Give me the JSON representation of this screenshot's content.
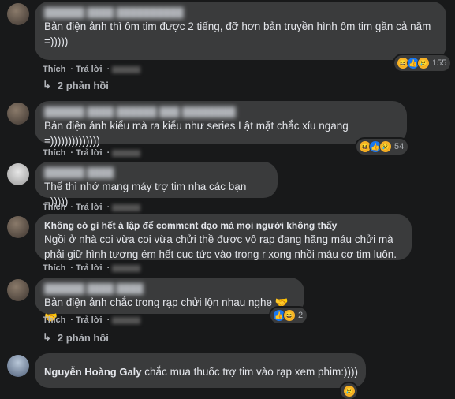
{
  "actions": {
    "like": "Thích",
    "reply": "Trả lời"
  },
  "comments": [
    {
      "name": "",
      "text": "Bản điện ảnh thì ôm tim được 2 tiếng, đỡ hơn bản truyền hình ôm tim gần cả năm =)))))",
      "reaction_count": "155",
      "reactions": [
        "haha-icon",
        "like-icon",
        "sad-icon"
      ],
      "replies": "2 phản hồi"
    },
    {
      "name": "",
      "text": "Bản điện ảnh kiểu mà ra kiểu như series Lật mặt chắc xỉu ngang =))))))))))))))",
      "reaction_count": "54",
      "reactions": [
        "haha-icon",
        "like-icon",
        "sad-icon"
      ]
    },
    {
      "name": "",
      "text": "Thế thì nhớ mang máy trợ tim nha các bạn =)))))"
    },
    {
      "name": "Không có gì hết á lập để comment dạo mà mọi người không thấy",
      "text": "Ngồi ở nhà coi vừa coi vừa chửi thề được vô rạp đang hăng máu chửi mà phải giữ hình tượng ém hết cục tức vào trong r xong nhồi máu cơ tim luôn."
    },
    {
      "name": "",
      "text": "Bản điện ảnh chắc trong rạp chửi lộn nhau nghe 🤝🤝",
      "reaction_count": "2",
      "reactions": [
        "like-icon",
        "haha-icon"
      ],
      "replies": "2 phản hồi"
    },
    {
      "name": "Nguyễn Hoàng Galy",
      "text": "chắc mua thuốc trợ tim vào rạp xem phim:))))",
      "reactions": [
        "sad-icon"
      ]
    }
  ]
}
